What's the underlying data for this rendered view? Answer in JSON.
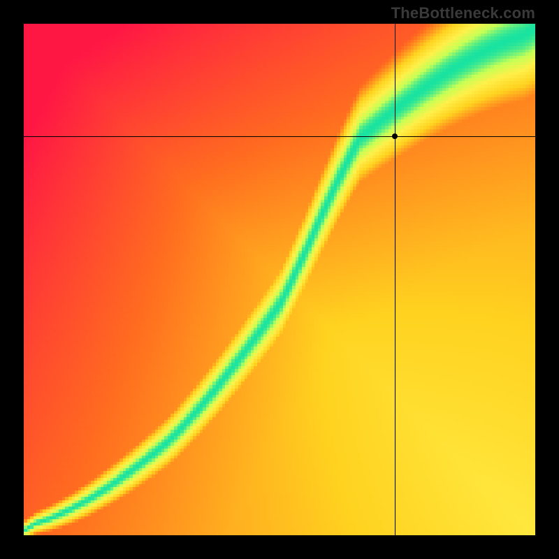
{
  "watermark": "TheBottleneck.com",
  "chart_data": {
    "type": "heatmap",
    "title": "",
    "xlabel": "",
    "ylabel": "",
    "xlim": [
      0,
      1
    ],
    "ylim": [
      0,
      1
    ],
    "grid": false,
    "legend": false,
    "colorscale": [
      {
        "t": 0.0,
        "color": "#ff1744"
      },
      {
        "t": 0.25,
        "color": "#ff6d1f"
      },
      {
        "t": 0.5,
        "color": "#ffd21f"
      },
      {
        "t": 0.72,
        "color": "#fff04a"
      },
      {
        "t": 0.88,
        "color": "#c6ff55"
      },
      {
        "t": 1.0,
        "color": "#19e3a0"
      }
    ],
    "ridge_curve_control_points": [
      {
        "x": 0.02,
        "y": 0.02
      },
      {
        "x": 0.28,
        "y": 0.18
      },
      {
        "x": 0.5,
        "y": 0.45
      },
      {
        "x": 0.66,
        "y": 0.78
      },
      {
        "x": 0.98,
        "y": 0.98
      }
    ],
    "ridge_half_width_start": 0.012,
    "ridge_half_width_end": 0.085,
    "background_diagonal_bias": 0.55,
    "crosshair": {
      "x": 0.725,
      "y": 0.78
    },
    "marker": {
      "x": 0.725,
      "y": 0.78
    },
    "resolution": 160
  }
}
